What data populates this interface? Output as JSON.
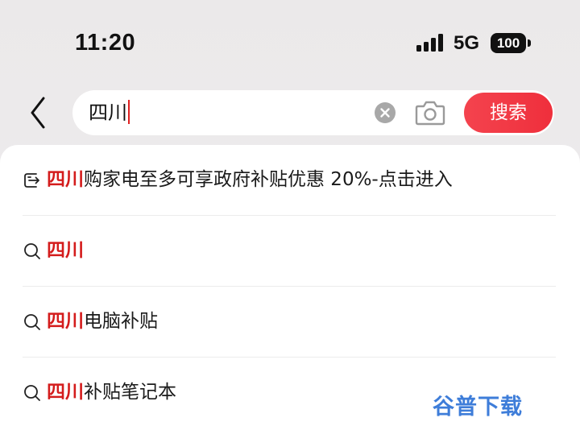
{
  "status_bar": {
    "time": "11:20",
    "network": "5G",
    "battery": "100",
    "signal_icon": "cellular-signal-icon"
  },
  "search": {
    "back_icon": "chevron-left-icon",
    "query": "四川",
    "clear_icon": "clear-circle-icon",
    "camera_icon": "camera-icon",
    "submit_label": "搜索",
    "accent_color": "#ef2f3c"
  },
  "suggestions": [
    {
      "icon": "promo-arrow-icon",
      "highlight": "四川",
      "rest": "购家电至多可享政府补贴优惠 20%-点击进入"
    },
    {
      "icon": "search-icon",
      "highlight": "四川",
      "rest": ""
    },
    {
      "icon": "search-icon",
      "highlight": "四川",
      "rest": "电脑补贴"
    },
    {
      "icon": "search-icon",
      "highlight": "四川",
      "rest": "补贴笔记本"
    }
  ],
  "highlight_color": "#d41c1c",
  "watermark": "谷普下载"
}
